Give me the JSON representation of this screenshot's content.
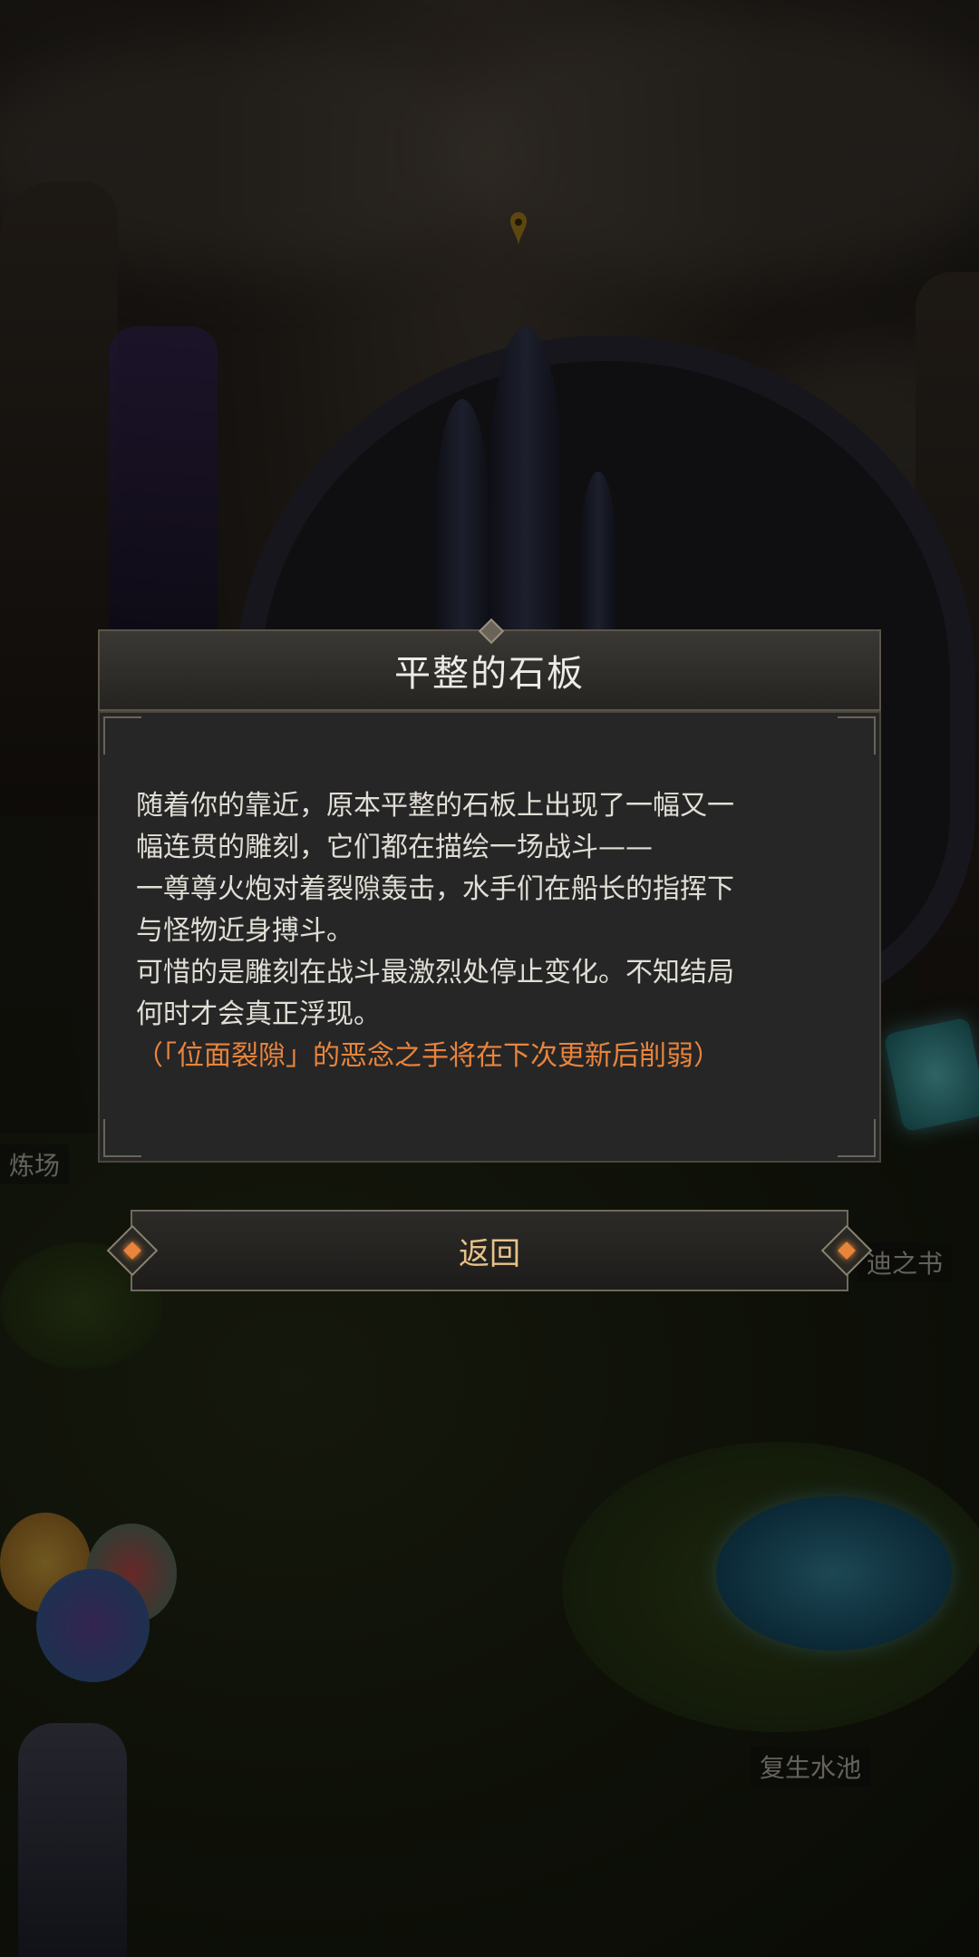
{
  "dialog": {
    "title": "平整的石板",
    "lines": [
      "随着你的靠近，原本平整的石板上出现了一幅又一",
      "幅连贯的雕刻，它们都在描绘一场战斗——",
      "一尊尊火炮对着裂隙轰击，水手们在船长的指挥下",
      "与怪物近身搏斗。",
      "可惜的是雕刻在战斗最激烈处停止变化。不知结局",
      "何时才会真正浮现。"
    ],
    "note": "（「位面裂隙」的恶念之手将在下次更新后削弱）",
    "back_label": "返回"
  },
  "map_labels": {
    "left": "炼场",
    "right": "迪之书",
    "pool": "复生水池"
  },
  "colors": {
    "note": "#e9843c",
    "button_text": "#e8c28a",
    "title_text": "#ecebe6"
  },
  "icons": [
    "map-pin-icon",
    "gem-icon"
  ]
}
